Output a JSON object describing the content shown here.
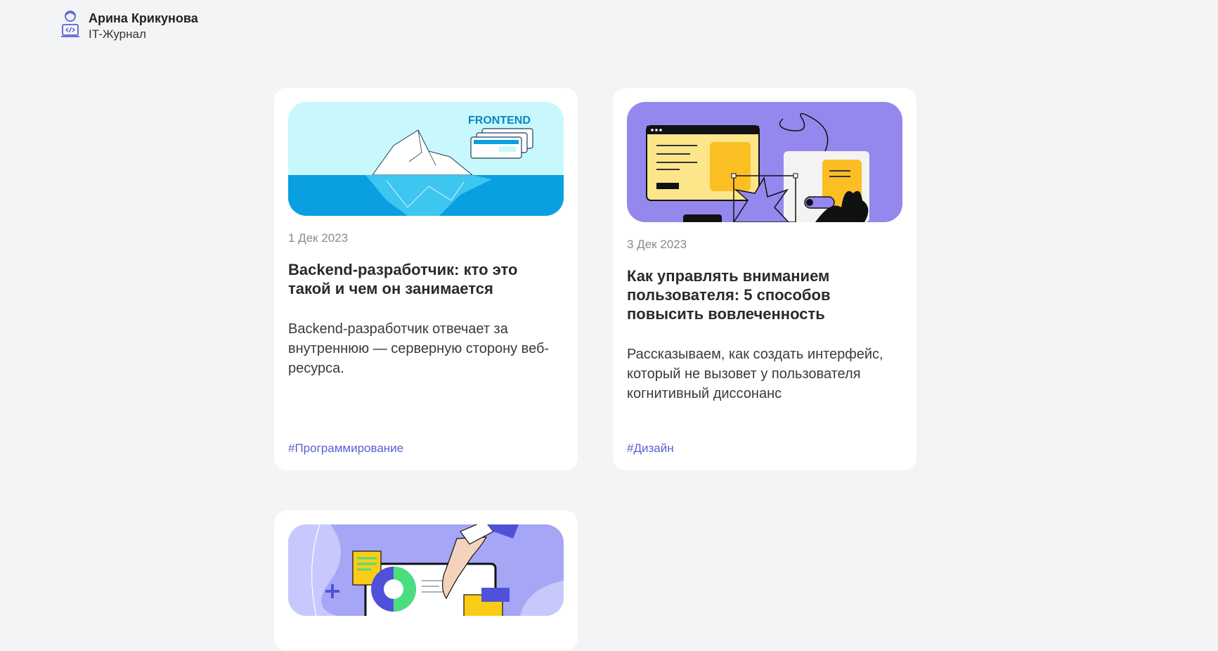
{
  "header": {
    "author": "Арина Крикунова",
    "journal": "IT-Журнал"
  },
  "cards": [
    {
      "date": "1 Дек 2023",
      "title": "Backend-разработчик: кто это такой и чем он занимается",
      "description": "Backend-разработчик отвечает за внутреннюю — серверную сторону веб-ресурса.",
      "tag": "#Программирование",
      "image_label": "FRONTEND"
    },
    {
      "date": "3 Дек 2023",
      "title": "Как управлять вниманием пользователя: 5 способов повысить вовлеченность",
      "description": "Рассказываем, как создать интерфейс, который не вызовет у пользователя когнитивный диссонанс",
      "tag": "#Дизайн"
    },
    {}
  ],
  "colors": {
    "accent": "#5b5fd0",
    "background": "#f3f4f6",
    "card": "#ffffff"
  }
}
